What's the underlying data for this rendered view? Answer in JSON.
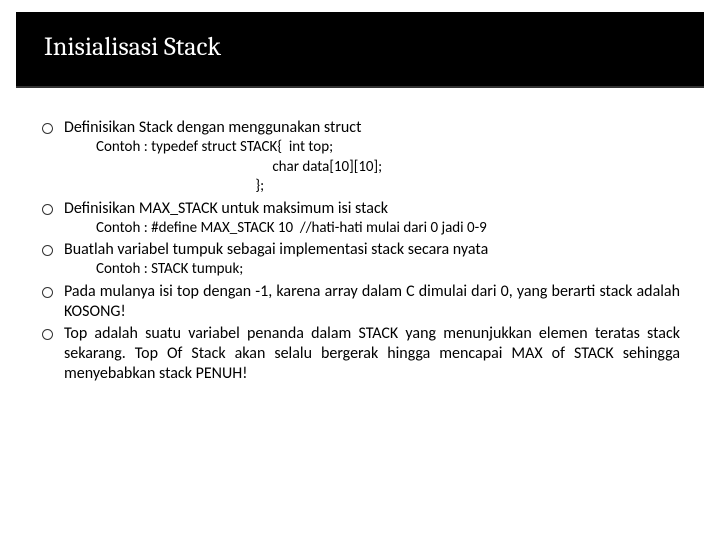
{
  "title": "Inisialisasi Stack",
  "items": [
    {
      "text": "Definisikan Stack dengan menggunakan struct",
      "sub": "Contoh : typedef struct STACK{  int top;\n                                                    char data[10][10];\n                                               };"
    },
    {
      "text": "Definisikan MAX_STACK untuk maksimum isi stack",
      "sub": "Contoh : #define MAX_STACK 10  //hati-hati mulai dari 0 jadi 0-9"
    },
    {
      "text": "Buatlah variabel tumpuk sebagai implementasi stack secara nyata",
      "sub": "Contoh : STACK tumpuk;"
    },
    {
      "text": "Pada mulanya isi top dengan -1, karena array dalam C dimulai dari 0, yang berarti stack adalah KOSONG!",
      "justify": true
    },
    {
      "text": "Top adalah suatu variabel penanda dalam STACK yang menunjukkan elemen teratas stack sekarang. Top Of Stack akan selalu bergerak hingga mencapai MAX of STACK sehingga menyebabkan stack PENUH!",
      "justify": true
    }
  ]
}
